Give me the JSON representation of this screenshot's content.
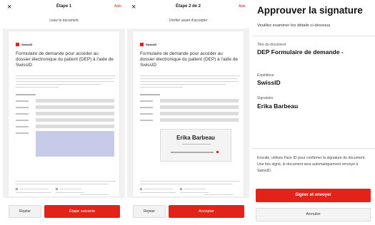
{
  "colors": {
    "accent": "#e2231a",
    "highlight": "#c5cbe9"
  },
  "screen1": {
    "close_icon": "×",
    "step_title": "Étape 1",
    "help": "Aide",
    "subtitle": "Lisez le document",
    "brand": "SwissID",
    "doc_title": "Formulaire de demande pour accéder au dossier électronique du patient (DEP) à l'aide de SwissID",
    "secondary_button": "Rejeter",
    "primary_button": "Étape suivante"
  },
  "screen2": {
    "close_icon": "×",
    "step_title": "Étape 2 de 2",
    "help": "Aide",
    "subtitle": "Vérifier avant d'accepter",
    "brand": "SwissID",
    "doc_title": "Formulaire de demande pour accéder au dossier électronique du patient (DEP) à l'aide de SwissID",
    "signature_name": "Erika Barbeau",
    "secondary_button": "Rejeter",
    "primary_button": "Accepter"
  },
  "screen3": {
    "title": "Approuver la signature",
    "subtitle": "Veuillez examiner les détails ci-dessous.",
    "doc_title_label": "Titre du document",
    "doc_title_value": "DEP Formulaire de demande -",
    "sender_label": "Expéditeur",
    "sender_value": "SwissID",
    "signatory_label": "Signataire",
    "signatory_value": "Erika Barbeau",
    "info_text": "Ensuite, utilisez Face ID pour confirmer la signature du document. Une fois signé, le document sera automatiquement renvoyé à SwissID.",
    "sign_button": "Signer et envoyer",
    "cancel_button": "Annuler"
  }
}
